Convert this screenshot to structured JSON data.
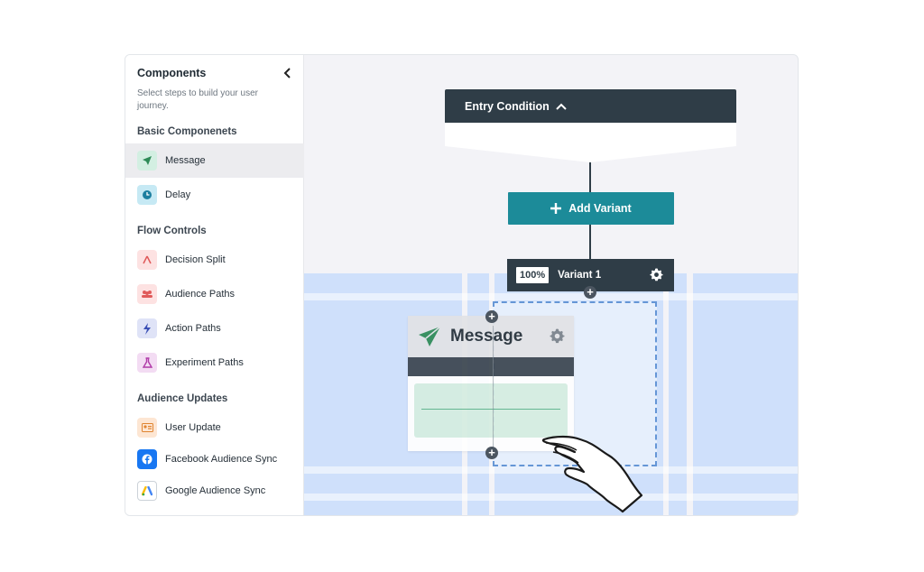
{
  "sidebar": {
    "title": "Components",
    "subtitle": "Select steps to build your user journey.",
    "sections": {
      "basic": "Basic Componenets",
      "flow": "Flow Controls",
      "audience": "Audience Updates"
    },
    "items": {
      "message": "Message",
      "delay": "Delay",
      "decision_split": "Decision Split",
      "audience_paths": "Audience Paths",
      "action_paths": "Action Paths",
      "experiment_paths": "Experiment Paths",
      "user_update": "User Update",
      "facebook_sync": "Facebook Audience Sync",
      "google_sync": "Google Audience Sync"
    }
  },
  "flow": {
    "entry_condition": "Entry Condition",
    "add_variant": "Add Variant",
    "variant_percent": "100%",
    "variant_name": "Variant 1"
  },
  "dragged": {
    "message_title": "Message"
  },
  "colors": {
    "teal": "#1c8b99",
    "dark": "#2f3d47",
    "message_green": "#2e8b57",
    "grid_blue": "#cfe0fb"
  },
  "icons": [
    "chevron-left-icon",
    "paper-plane-icon",
    "clock-icon",
    "split-icon",
    "people-icon",
    "lightning-icon",
    "flask-icon",
    "id-card-icon",
    "facebook-icon",
    "google-ads-icon",
    "chevron-up-icon",
    "plus-icon",
    "gear-icon",
    "hand-cursor-icon"
  ]
}
